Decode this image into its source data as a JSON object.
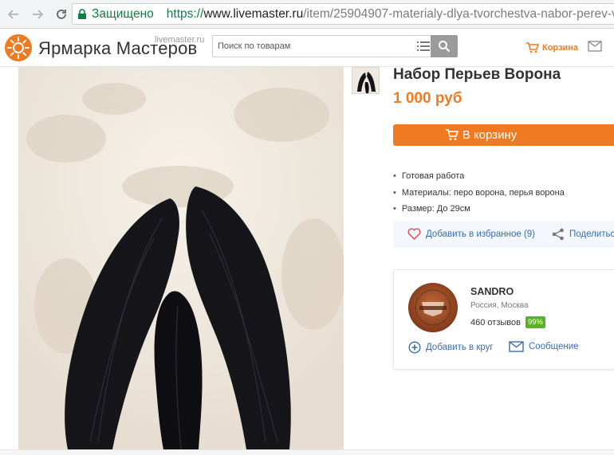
{
  "browser": {
    "secure_label": "Защищено",
    "url_scheme": "https://",
    "url_domain": "www.livemaster.ru",
    "url_path": "/item/25904907-materialy-dlya-tvorchestva-nabor-perev-voro..."
  },
  "header": {
    "logo_text": "Ярмарка Мастеров",
    "logo_subtext": "livemaster.ru",
    "search_placeholder": "Поиск по товарам",
    "cart_label": "Корзина",
    "accent_color": "#f07a22"
  },
  "product": {
    "title": "Набор Перьев Ворона",
    "price": "1 000 руб",
    "buy_label": "В корзину",
    "properties": [
      "Готовая работа",
      "Материалы:  перо ворона, перья ворона",
      "Размер: До 29см"
    ],
    "favorite_label": "Добавить в избранное (9)",
    "share_label": "Поделиться"
  },
  "seller": {
    "name": "SANDRO",
    "city": "Россия, Москва",
    "reviews": "460 отзывов",
    "rating": "99%",
    "add_circle_label": "Добавить в круг",
    "message_label": "Сообщение",
    "rating_color": "#5cb31e"
  }
}
